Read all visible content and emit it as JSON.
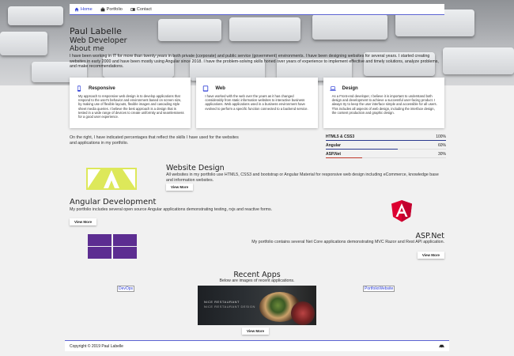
{
  "nav": {
    "items": [
      {
        "label": "Home",
        "icon": "home-icon"
      },
      {
        "label": "Portfolio",
        "icon": "briefcase-icon"
      },
      {
        "label": "Contact",
        "icon": "card-icon"
      }
    ]
  },
  "hero": {
    "name": "Paul Labelle",
    "role": "Web Developer",
    "about_heading": "About me",
    "body": "I have been working in IT for more than twenty years in both private (corporate) and public service (government) environments. I have been designing websites for several years. I started creating websites in early 2000 and have been mostly using Angular since 2018. I have the problem-solving skills honed over years of experience to implement effective and timely solutions, analyze problems, and make recommendations."
  },
  "cards": [
    {
      "title": "Responsive",
      "icon": "mobile-icon",
      "text": "My approach to responsive web design is to develop applications that respond to the user's behavior and environment based on screen size, by making use of flexible layouts, flexible images and cascading style sheet media queries. I believe the best approach is a design that is tested in a wide range of devices to create uniformity and seamlessness for a good user experience."
    },
    {
      "title": "Web",
      "icon": "tablet-icon",
      "text": "I have worked with the web over the years as it has changed considerably from static information websites to interactive business applications. Web applications used in a business environment have evolved to perform a specific function connected to a backend service."
    },
    {
      "title": "Design",
      "icon": "laptop-icon",
      "text": "As a Front-end developer, I believe it is important to understand both design and development to achieve a successful user-facing product. I always try to keep the user interface simple and accessible for all users. This includes all aspects of web design, including the interface design, the content production and graphic design."
    }
  ],
  "skills": {
    "intro": "On the right, I have indicated percentages that reflect the skills I have used for the websites and applications in my portfolio.",
    "items": [
      {
        "name": "HTML5 & CSS3",
        "percent_label": "100%",
        "percent": 100,
        "color": "#2b3a8f"
      },
      {
        "name": "Angular",
        "percent_label": "60%",
        "percent": 60,
        "color": "#2b3a8f"
      },
      {
        "name": "ASP.Net",
        "percent_label": "30%",
        "percent": 30,
        "color": "#c0392b"
      }
    ]
  },
  "website_design": {
    "title": "Website Design",
    "text": "All websites in my portfolio use HTML5, CSS3 and bootstrap or Angular Material for responsive web design including eCommerce, knowledge base and information websites.",
    "button": "View More",
    "logo_color": "#dde85a"
  },
  "angular": {
    "title": "Angular Development",
    "text": "My portfolio includes several open source Angular applications demonstrating testing, rxjs and reactive forms.",
    "button": "View More",
    "logo_color": "#dd0031"
  },
  "aspnet": {
    "title": "ASP.Net",
    "text": "My portfolio contains several Net Core applications demonstrating MVC Razor and Rest API application.",
    "button": "View More",
    "logo_color": "#5c2d91"
  },
  "recent": {
    "title": "Recent Apps",
    "subtitle": "Below are images of recent applications.",
    "left_link": "DevOps",
    "right_link": "PortfolioWebsite",
    "shot_line1": "NICE RESTAURANT",
    "shot_line2": "NICE RESTAURANT DESIGN",
    "button": "View More"
  },
  "footer": {
    "copyright": "Copyright © 2019 Paul Labelle",
    "icon": "car-icon"
  }
}
